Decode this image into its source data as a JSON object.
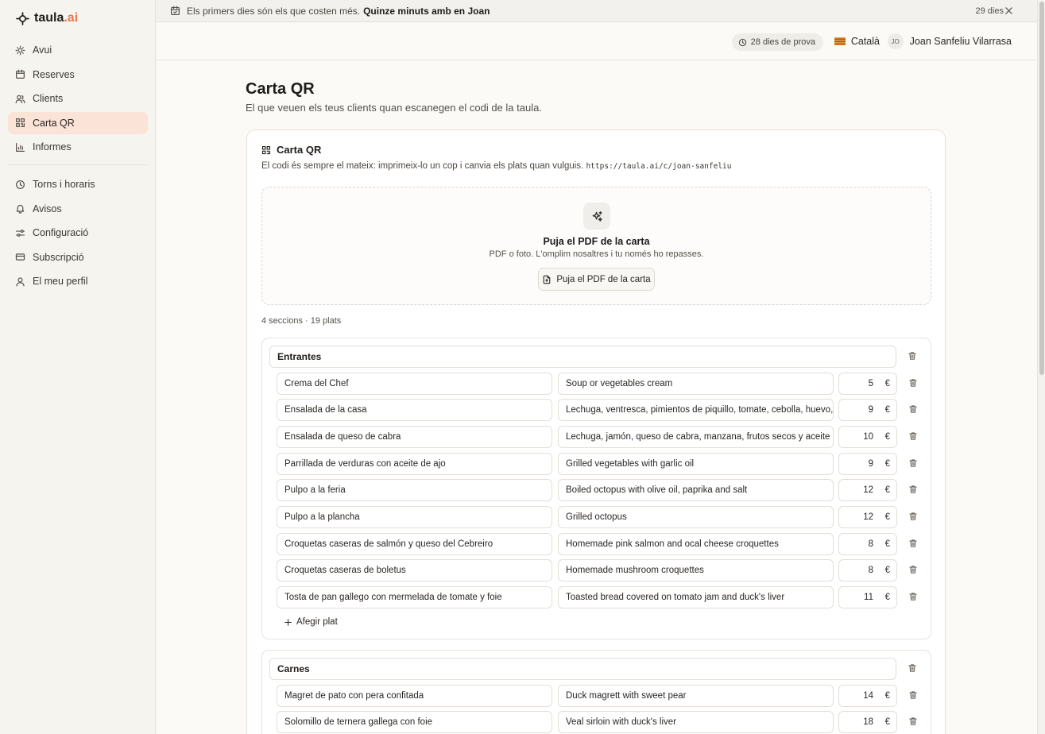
{
  "app": {
    "logo_name": "taula",
    "logo_ext": ".ai"
  },
  "sidebar": {
    "primary": [
      {
        "label": "Avui",
        "icon": "sun-icon"
      },
      {
        "label": "Reserves",
        "icon": "calendar-icon"
      },
      {
        "label": "Clients",
        "icon": "users-icon"
      },
      {
        "label": "Carta QR",
        "icon": "qr-code-icon",
        "active": true
      },
      {
        "label": "Informes",
        "icon": "bar-chart-icon"
      }
    ],
    "secondary": [
      {
        "label": "Torns i horaris",
        "icon": "clock-icon"
      },
      {
        "label": "Avisos",
        "icon": "bell-icon"
      },
      {
        "label": "Configuració",
        "icon": "sliders-icon"
      },
      {
        "label": "Subscripció",
        "icon": "credit-card-icon"
      },
      {
        "label": "El meu perfil",
        "icon": "user-icon"
      }
    ]
  },
  "banner": {
    "text": "Els primers dies són els que costen més.",
    "cta": "Quinze minuts amb en Joan",
    "days_left": "29 dies"
  },
  "header": {
    "trial": "28 dies de prova",
    "language": "Català",
    "user_initials": "JO",
    "user_name": "Joan Sanfeliu Vilarrasa"
  },
  "page": {
    "title": "Carta QR",
    "subtitle": "El que veuen els teus clients quan escanegen el codi de la taula."
  },
  "card": {
    "title": "Carta QR",
    "description": "El codi és sempre el mateix: imprimeix-lo un cop i canvia els plats quan vulguis.",
    "url": "https://taula.ai/c/joan-sanfeliu",
    "upload": {
      "title": "Puja el PDF de la carta",
      "subtitle": "PDF o foto. L'omplim nosaltres i tu només ho repasses.",
      "button": "Puja el PDF de la carta"
    },
    "counts": "4 seccions · 19 plats"
  },
  "currency": "€",
  "add_dish_label": "Afegir plat",
  "sections": [
    {
      "name": "Entrantes",
      "dishes": [
        {
          "name": "Crema del Chef",
          "description": "Soup or vegetables cream",
          "price": "5"
        },
        {
          "name": "Ensalada de la casa",
          "description": "Lechuga, ventresca, pimientos de piquillo, tomate, cebolla, huevo, aceitunas",
          "price": "9"
        },
        {
          "name": "Ensalada de queso de cabra",
          "description": "Lechuga, jamón, queso de cabra, manzana, frutos secos y aceite de avellana",
          "price": "10"
        },
        {
          "name": "Parrillada de verduras con aceite de ajo",
          "description": "Grilled vegetables with garlic oil",
          "price": "9"
        },
        {
          "name": "Pulpo a la feria",
          "description": "Boiled octopus with olive oil, paprika and salt",
          "price": "12"
        },
        {
          "name": "Pulpo a la plancha",
          "description": "Grilled octopus",
          "price": "12"
        },
        {
          "name": "Croquetas caseras de salmón y queso del Cebreiro",
          "description": "Homemade pink salmon and ocal cheese croquettes",
          "price": "8"
        },
        {
          "name": "Croquetas caseras de boletus",
          "description": "Homemade mushroom croquettes",
          "price": "8"
        },
        {
          "name": "Tosta de pan gallego con mermelada de tomate y foie",
          "description": "Toasted bread covered on tomato jam and duck's liver",
          "price": "11"
        }
      ]
    },
    {
      "name": "Carnes",
      "dishes": [
        {
          "name": "Magret de pato con pera confitada",
          "description": "Duck magrett with sweet pear",
          "price": "14"
        },
        {
          "name": "Solomillo de ternera gallega con foie",
          "description": "Veal sirloin with duck's liver",
          "price": "18"
        }
      ]
    }
  ]
}
